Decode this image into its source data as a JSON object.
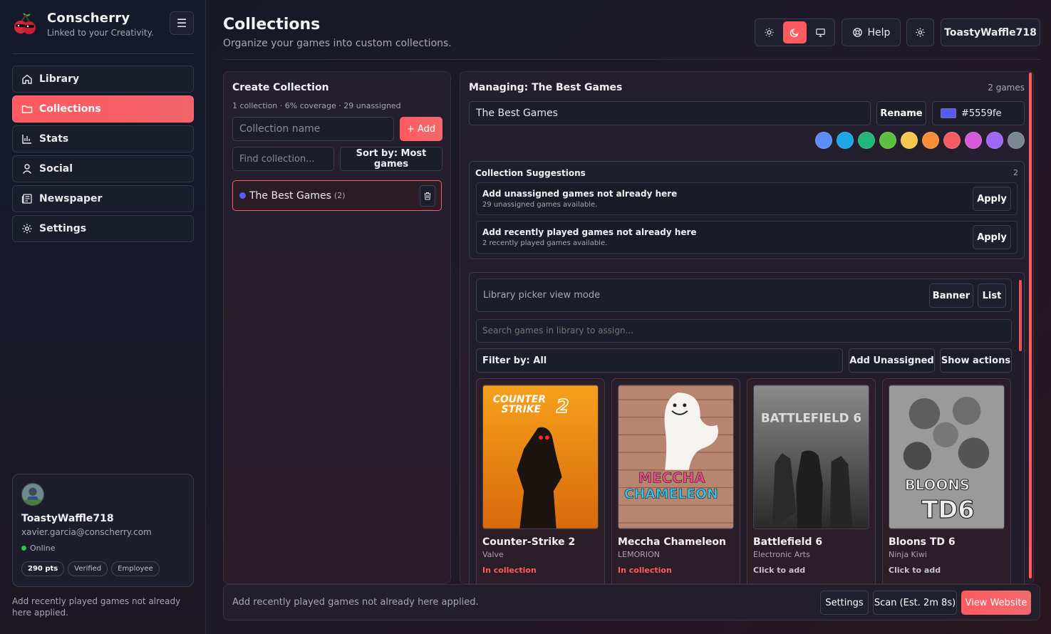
{
  "app": {
    "name": "Conscherry",
    "tagline": "Linked to your Creativity."
  },
  "sidebar": {
    "items": [
      {
        "label": "Library",
        "icon": "home-icon",
        "active": false
      },
      {
        "label": "Collections",
        "icon": "folder-icon",
        "active": true
      },
      {
        "label": "Stats",
        "icon": "bar-chart-icon",
        "active": false
      },
      {
        "label": "Social",
        "icon": "user-icon",
        "active": false
      },
      {
        "label": "Newspaper",
        "icon": "newspaper-icon",
        "active": false
      },
      {
        "label": "Settings",
        "icon": "gear-icon",
        "active": false
      }
    ],
    "profile": {
      "name": "ToastyWaffle718",
      "email": "xavier.garcia@conscherry.com",
      "status": "Online",
      "badges": [
        "290 pts",
        "Verified",
        "Employee"
      ]
    },
    "footnote": "Add recently played games not already here applied."
  },
  "header": {
    "title": "Collections",
    "subtitle": "Organize your games into custom collections.",
    "theme_modes": [
      "light",
      "dark",
      "system"
    ],
    "active_theme": "dark",
    "help_label": "Help",
    "user_label": "ToastyWaffle718"
  },
  "create": {
    "title": "Create Collection",
    "stats": "1 collection · 6% coverage · 29 unassigned",
    "name_placeholder": "Collection name",
    "add_label": "+ Add",
    "find_placeholder": "Find collection...",
    "sort_label": "Sort by: Most games",
    "collections": [
      {
        "name": "The Best Games",
        "count": "(2)",
        "color": "#5559fe"
      }
    ]
  },
  "manage": {
    "title": "Managing: The Best Games",
    "count": "2 games",
    "name_value": "The Best Games",
    "rename_label": "Rename",
    "color_value": "#5559fe",
    "palette": [
      "#5b8cf7",
      "#1ba7e6",
      "#1fb87a",
      "#5cc13e",
      "#f6c84f",
      "#f78d36",
      "#f35c63",
      "#d65bd8",
      "#9e68f3",
      "#7c8594"
    ],
    "suggestions": {
      "title": "Collection Suggestions",
      "count": "2",
      "items": [
        {
          "title": "Add unassigned games not already here",
          "sub": "29 unassigned games available.",
          "action": "Apply"
        },
        {
          "title": "Add recently played games not already here",
          "sub": "2 recently played games available.",
          "action": "Apply"
        }
      ]
    },
    "picker": {
      "mode_label": "Library picker view mode",
      "banner_label": "Banner",
      "list_label": "List",
      "search_placeholder": "Search games in library to assign...",
      "filter_label": "Filter by: All",
      "add_unassigned_label": "Add Unassigned",
      "show_actions_label": "Show actions"
    },
    "games": [
      {
        "title": "Counter-Strike 2",
        "developer": "Valve",
        "state": "In collection",
        "in_collection": true
      },
      {
        "title": "Meccha Chameleon",
        "developer": "LEMORION",
        "state": "In collection",
        "in_collection": true
      },
      {
        "title": "Battlefield 6",
        "developer": "Electronic Arts",
        "state": "Click to add",
        "in_collection": false
      },
      {
        "title": "Bloons TD 6",
        "developer": "Ninja Kiwi",
        "state": "Click to add",
        "in_collection": false
      }
    ]
  },
  "cover_art": {
    "cs2_line1": "COUNTER",
    "cs2_line2": "STRIKE",
    "cs2_num": "2",
    "meccha_line1": "MECCHA",
    "meccha_line2": "CHAMELEON",
    "bf6_text": "BATTLEFIELD 6",
    "btd_line1": "BLOONS",
    "btd_line2": "TD6"
  },
  "bottom": {
    "message": "Add recently played games not already here applied.",
    "settings_label": "Settings",
    "scan_label": "Scan (Est. 2m 8s)",
    "website_label": "View Website"
  }
}
